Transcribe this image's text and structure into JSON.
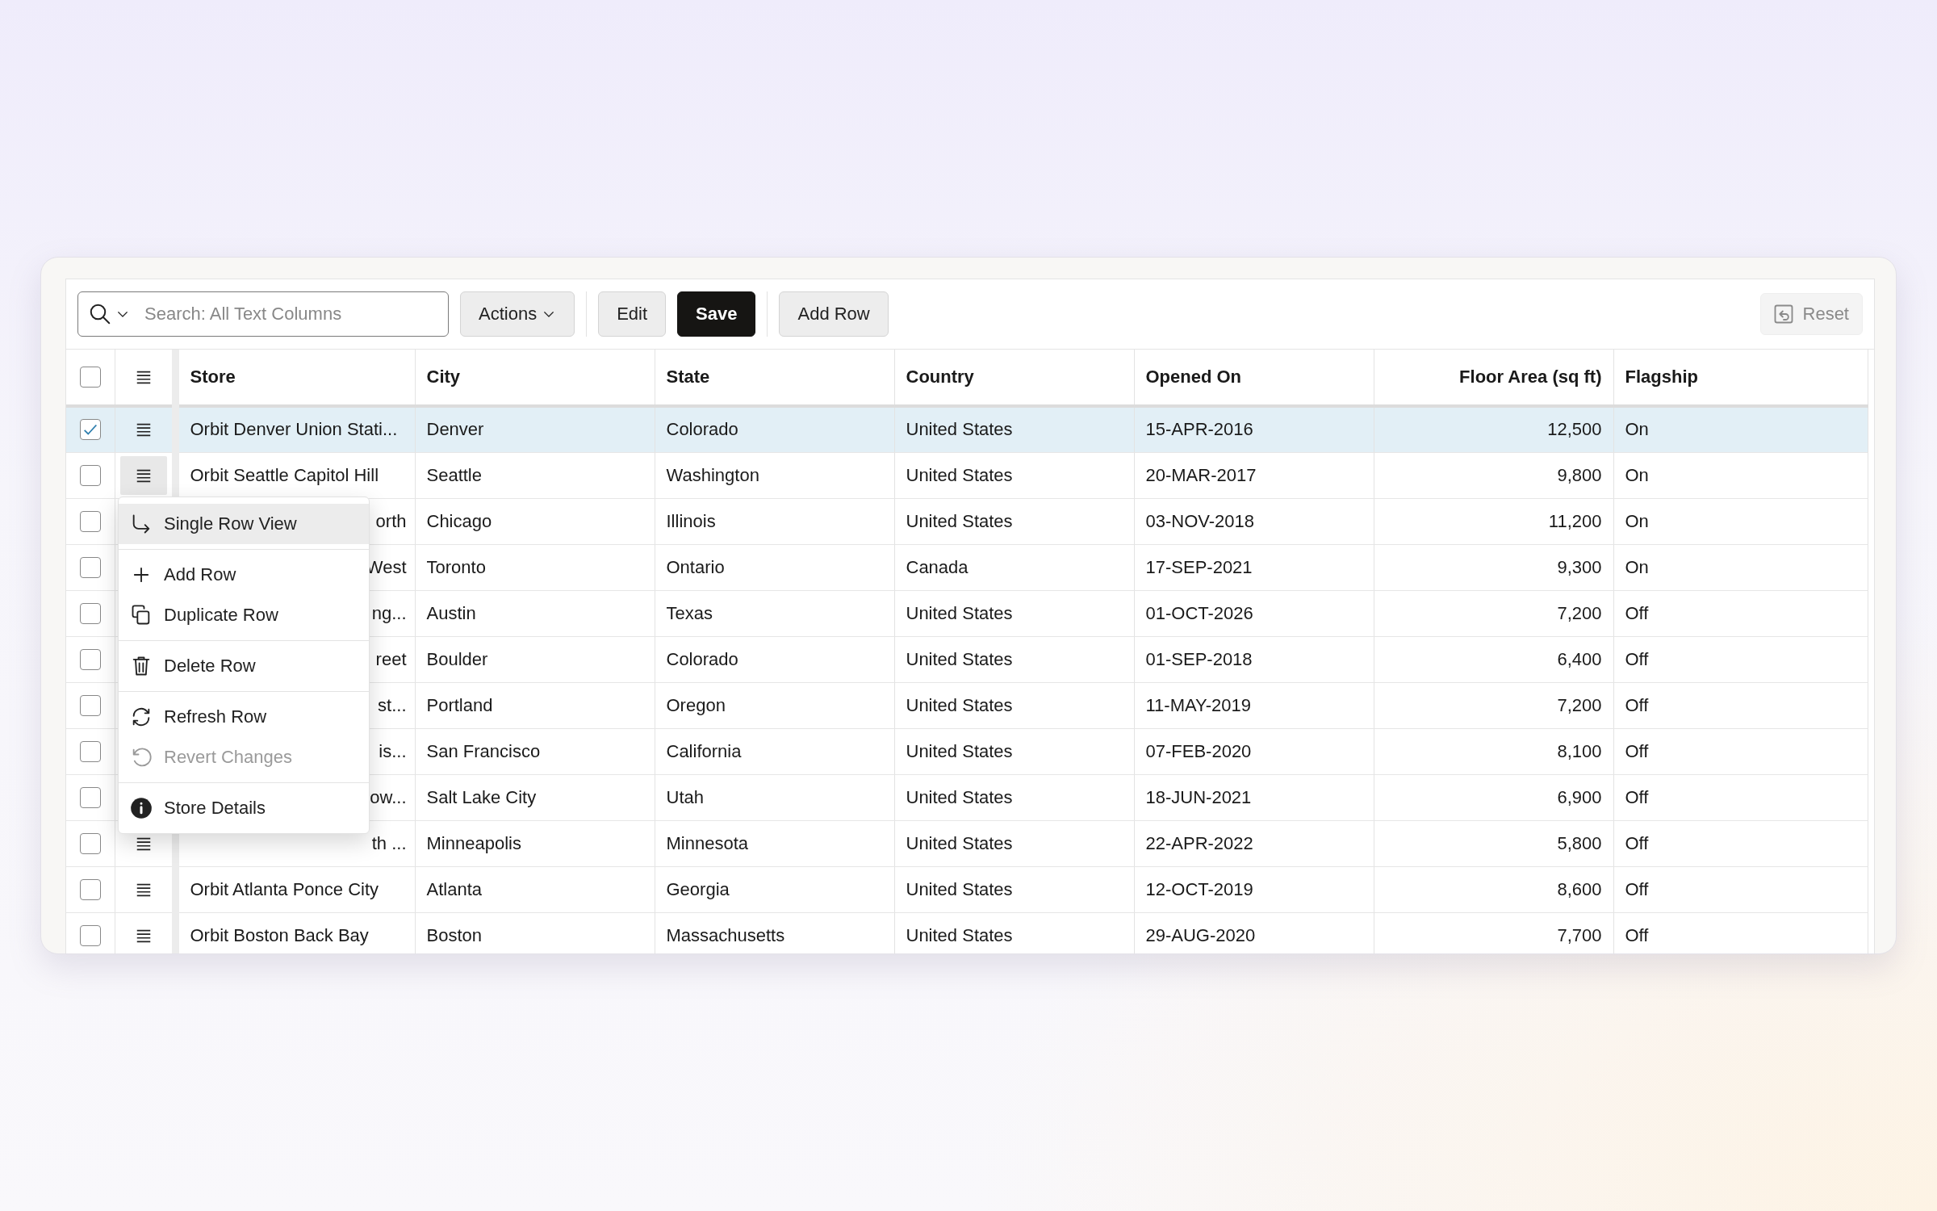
{
  "toolbar": {
    "search": {
      "placeholder": "Search: All Text Columns"
    },
    "buttons": [
      {
        "label": "Actions",
        "kind": "dropdown"
      },
      {
        "label": "Edit",
        "kind": "plain"
      },
      {
        "label": "Save",
        "kind": "primary"
      },
      {
        "label": "Add Row",
        "kind": "plain"
      }
    ],
    "reset": {
      "label": "Reset",
      "disabled": true
    }
  },
  "table": {
    "select_all": {
      "checked": false
    },
    "columns": [
      {
        "label": "Store",
        "kind": "text"
      },
      {
        "label": "City",
        "kind": "text"
      },
      {
        "label": "State",
        "kind": "text"
      },
      {
        "label": "Country",
        "kind": "text"
      },
      {
        "label": "Opened On",
        "kind": "text"
      },
      {
        "label": "Floor Area (sq ft)",
        "kind": "number"
      },
      {
        "label": "Flagship",
        "kind": "text"
      }
    ],
    "rows": [
      {
        "selected": true,
        "menu_open": false,
        "covered": false,
        "cells": [
          "Orbit Denver Union Stati...",
          "Denver",
          "Colorado",
          "United States",
          "15-APR-2016",
          "12,500",
          "On"
        ]
      },
      {
        "selected": false,
        "menu_open": true,
        "covered": false,
        "cells": [
          "Orbit Seattle Capitol Hill",
          "Seattle",
          "Washington",
          "United States",
          "20-MAR-2017",
          "9,800",
          "On"
        ]
      },
      {
        "selected": false,
        "menu_open": false,
        "covered": true,
        "cells": [
          "orth",
          "Chicago",
          "Illinois",
          "United States",
          "03-NOV-2018",
          "11,200",
          "On"
        ]
      },
      {
        "selected": false,
        "menu_open": false,
        "covered": true,
        "cells": [
          "West",
          "Toronto",
          "Ontario",
          "Canada",
          "17-SEP-2021",
          "9,300",
          "On"
        ]
      },
      {
        "selected": false,
        "menu_open": false,
        "covered": true,
        "cells": [
          "ng...",
          "Austin",
          "Texas",
          "United States",
          "01-OCT-2026",
          "7,200",
          "Off"
        ]
      },
      {
        "selected": false,
        "menu_open": false,
        "covered": true,
        "cells": [
          "reet",
          "Boulder",
          "Colorado",
          "United States",
          "01-SEP-2018",
          "6,400",
          "Off"
        ]
      },
      {
        "selected": false,
        "menu_open": false,
        "covered": true,
        "cells": [
          "st...",
          "Portland",
          "Oregon",
          "United States",
          "11-MAY-2019",
          "7,200",
          "Off"
        ]
      },
      {
        "selected": false,
        "menu_open": false,
        "covered": true,
        "cells": [
          "is...",
          "San Francisco",
          "California",
          "United States",
          "07-FEB-2020",
          "8,100",
          "Off"
        ]
      },
      {
        "selected": false,
        "menu_open": false,
        "covered": true,
        "cells": [
          "ow...",
          "Salt Lake City",
          "Utah",
          "United States",
          "18-JUN-2021",
          "6,900",
          "Off"
        ]
      },
      {
        "selected": false,
        "menu_open": false,
        "covered": true,
        "cells": [
          "th ...",
          "Minneapolis",
          "Minnesota",
          "United States",
          "22-APR-2022",
          "5,800",
          "Off"
        ]
      },
      {
        "selected": false,
        "menu_open": false,
        "covered": false,
        "cells": [
          "Orbit Atlanta Ponce City",
          "Atlanta",
          "Georgia",
          "United States",
          "12-OCT-2019",
          "8,600",
          "Off"
        ]
      },
      {
        "selected": false,
        "menu_open": false,
        "covered": false,
        "cells": [
          "Orbit Boston Back Bay",
          "Boston",
          "Massachusetts",
          "United States",
          "29-AUG-2020",
          "7,700",
          "Off"
        ]
      }
    ]
  },
  "row_menu": {
    "items": [
      {
        "kind": "item",
        "label": "Single Row View",
        "selected": true,
        "disabled": false
      },
      {
        "kind": "separator"
      },
      {
        "kind": "item",
        "label": "Add Row",
        "selected": false,
        "disabled": false
      },
      {
        "kind": "item",
        "label": "Duplicate Row",
        "selected": false,
        "disabled": false
      },
      {
        "kind": "separator"
      },
      {
        "kind": "item",
        "label": "Delete Row",
        "selected": false,
        "disabled": false
      },
      {
        "kind": "separator"
      },
      {
        "kind": "item",
        "label": "Refresh Row",
        "selected": false,
        "disabled": false
      },
      {
        "kind": "item",
        "label": "Revert Changes",
        "selected": false,
        "disabled": true
      },
      {
        "kind": "separator"
      },
      {
        "kind": "item",
        "label": "Store Details",
        "selected": false,
        "disabled": false
      }
    ]
  }
}
